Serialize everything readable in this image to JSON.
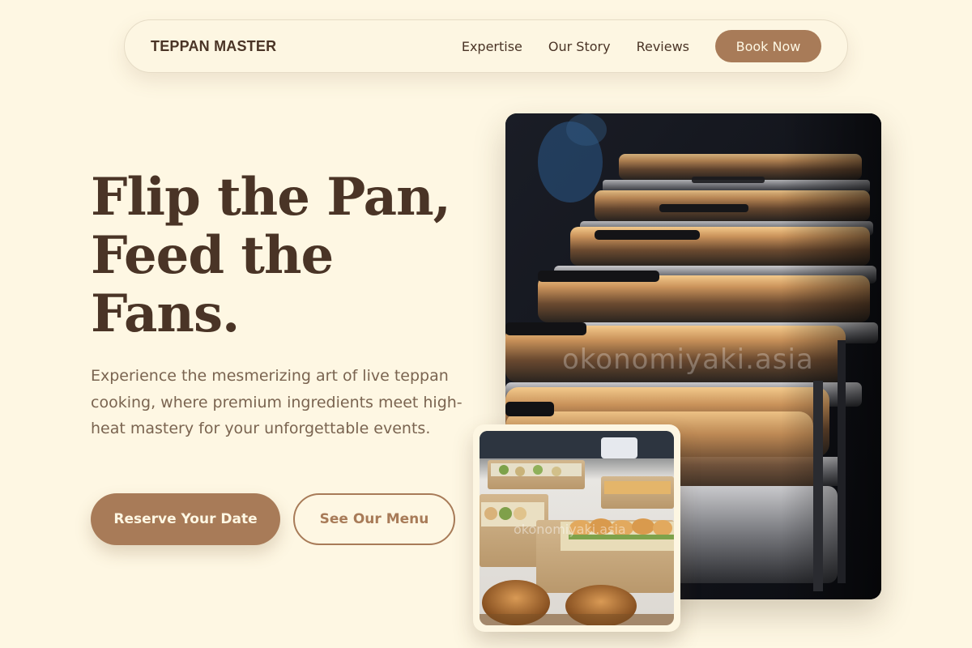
{
  "nav": {
    "brand": "TEPPAN MASTER",
    "links": [
      "Expertise",
      "Our Story",
      "Reviews"
    ],
    "cta": "Book Now"
  },
  "hero": {
    "title_lines": [
      "Flip the Pan,",
      "Feed the",
      "Fans."
    ],
    "description": "Experience the mesmerizing art of live teppan cooking, where premium ingredients meet high-heat mastery for your unforgettable events.",
    "primary_button": "Reserve Your Date",
    "secondary_button": "See Our Menu"
  },
  "images": {
    "main_watermark": "okonomiyaki.asia",
    "small_watermark": "okonomiyaki.asia"
  },
  "colors": {
    "background": "#fef7e3",
    "accent": "#a87b58",
    "text_dark": "#4a3426",
    "text_muted": "#7a6450"
  }
}
